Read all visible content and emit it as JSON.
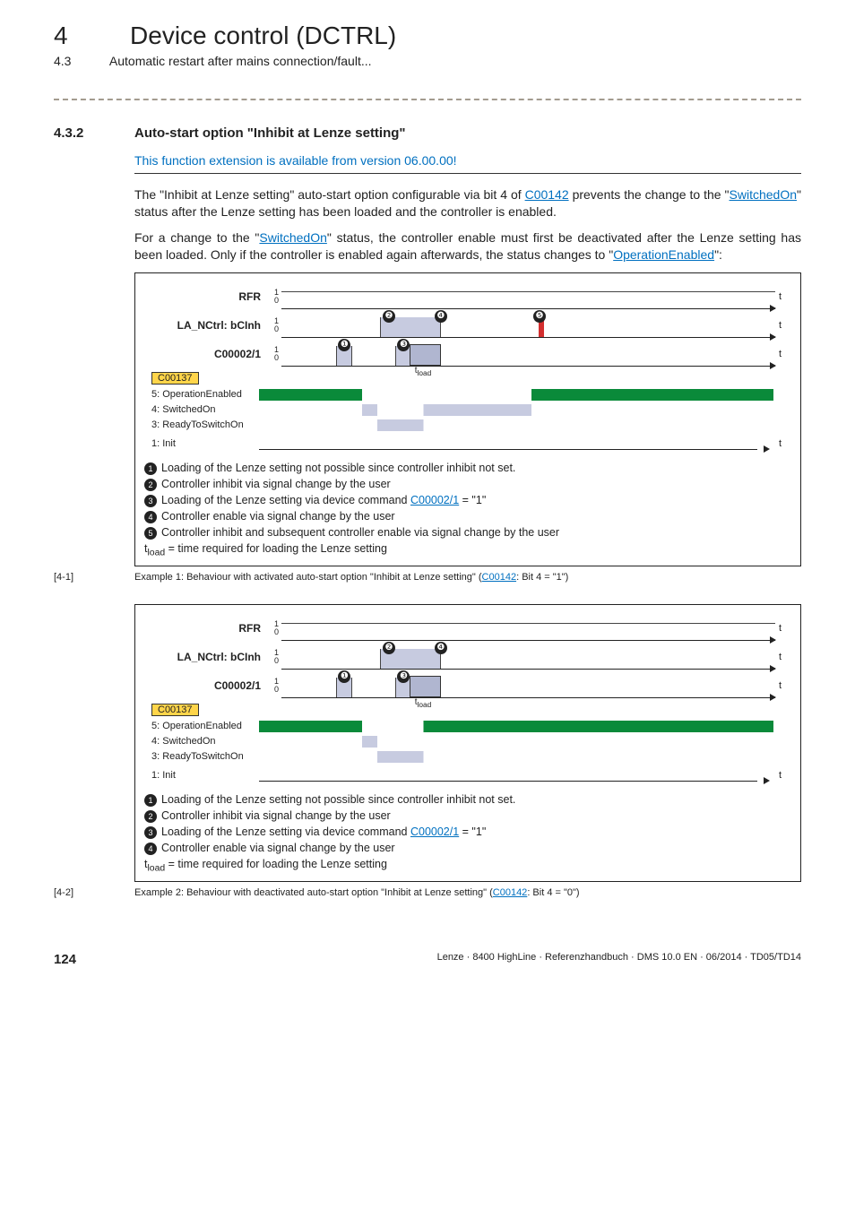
{
  "chapter": {
    "num": "4",
    "title": "Device control (DCTRL)"
  },
  "section": {
    "num": "4.3",
    "title": "Automatic restart after mains connection/fault..."
  },
  "subsection": {
    "num": "4.3.2",
    "title": "Auto-start option \"Inhibit at Lenze setting\""
  },
  "availability": "This function extension is available from version 06.00.00!",
  "para1": {
    "a": "The  \"Inhibit at Lenze setting\" auto-start option configurable via bit 4 of ",
    "link": "C00142",
    "b": " prevents the change to the \"",
    "link2": "SwitchedOn",
    "c": "\" status after the Lenze setting has been loaded and the controller is enabled."
  },
  "para2": {
    "a": "For a change to the \"",
    "link": "SwitchedOn",
    "b": "\" status, the controller enable must first be deactivated after the Lenze setting has been loaded. Only if the controller is enabled again afterwards, the status changes to \"",
    "link2": "OperationEnabled",
    "c": "\":"
  },
  "diagram": {
    "rows": [
      "RFR",
      "LA_NCtrl: bCInh",
      "C00002/1"
    ],
    "c137": "C00137",
    "states": [
      "5: OperationEnabled",
      "4: SwitchedOn",
      "3: ReadyToSwitchOn",
      "1: Init"
    ],
    "tload": "t",
    "tload_sub": "load",
    "zero": "0",
    "one": "1",
    "t": "t"
  },
  "legend1": [
    {
      "n": "❶",
      "t": "Loading of the Lenze setting not possible since controller inhibit not set."
    },
    {
      "n": "❷",
      "t": "Controller inhibit via signal change by the user"
    },
    {
      "n": "❸",
      "t1": "Loading of the Lenze setting via device command ",
      "link": "C00002/1",
      "t2": " = \"1\""
    },
    {
      "n": "❹",
      "t": "Controller enable via signal change by the user"
    },
    {
      "n": "❺",
      "t": "Controller inhibit and subsequent controller enable via signal change by the user"
    }
  ],
  "tload_line": {
    "a": "t",
    "sub": "load",
    "b": " = time required for loading the Lenze setting"
  },
  "caption1": {
    "num": "[4-1]",
    "a": "Example 1: Behaviour with activated auto-start option \"Inhibit at Lenze setting\" (",
    "link": "C00142",
    "b": ": Bit 4 = \"1\")"
  },
  "legend2": [
    {
      "n": "❶",
      "t": "Loading of the Lenze setting not possible since controller inhibit not set."
    },
    {
      "n": "❷",
      "t": "Controller inhibit via signal change by the user"
    },
    {
      "n": "❸",
      "t1": "Loading of the Lenze setting via device command ",
      "link": "C00002/1",
      "t2": " = \"1\""
    },
    {
      "n": "❹",
      "t": "Controller enable via signal change by the user"
    }
  ],
  "caption2": {
    "num": "[4-2]",
    "a": "Example 2: Behaviour with deactivated auto-start option \"Inhibit at Lenze setting\" (",
    "link": "C00142",
    "b": ": Bit 4 = \"0\")"
  },
  "footer": {
    "page": "124",
    "text": "Lenze · 8400 HighLine · Referenzhandbuch · DMS 10.0 EN · 06/2014 · TD05/TD14"
  },
  "chart_data": [
    {
      "type": "timing",
      "title": "Example 1 (Inhibit active)",
      "signals": {
        "RFR": [
          [
            0,
            1
          ],
          [
            1,
            1
          ]
        ],
        "LA_NCtrl:bCInh": [
          [
            0,
            0
          ],
          [
            0.18,
            1
          ],
          [
            0.3,
            0
          ],
          [
            0.52,
            0
          ]
        ],
        "C00002/1": [
          [
            0.12,
            "pulse"
          ],
          [
            0.23,
            "pulse"
          ]
        ],
        "C00137": [
          "OperationEnabled",
          "OperationEnabled",
          "SwitchedOn",
          "ReadyToSwitchOn",
          "OperationEnabled"
        ]
      },
      "markers": [
        "❶",
        "❷",
        "❸",
        "❹",
        "❺"
      ]
    },
    {
      "type": "timing",
      "title": "Example 2 (Inhibit inactive)",
      "signals": {
        "RFR": [
          [
            0,
            1
          ],
          [
            1,
            1
          ]
        ],
        "LA_NCtrl:bCInh": [
          [
            0,
            0
          ],
          [
            0.18,
            1
          ],
          [
            0.3,
            0
          ]
        ],
        "C00002/1": [
          [
            0.12,
            "pulse"
          ],
          [
            0.23,
            "pulse"
          ]
        ],
        "C00137": [
          "OperationEnabled",
          "OperationEnabled",
          "ReadyToSwitchOn",
          "OperationEnabled"
        ]
      },
      "markers": [
        "❶",
        "❷",
        "❸",
        "❹"
      ]
    }
  ]
}
